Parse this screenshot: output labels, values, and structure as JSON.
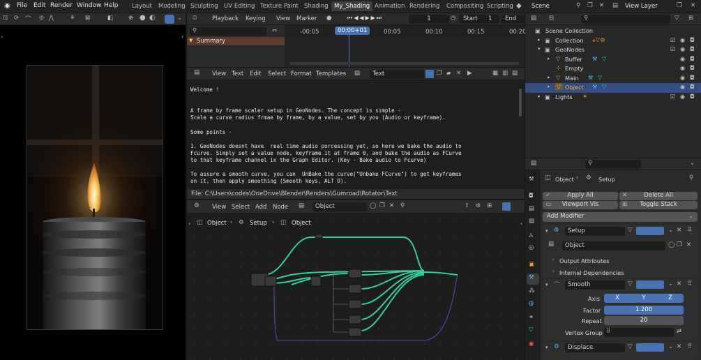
{
  "menu": [
    "File",
    "Edit",
    "Render",
    "Window",
    "Help"
  ],
  "workspaces": [
    "Layout",
    "Modeling",
    "Sculpting",
    "UV Editing",
    "Texture Paint",
    "Shading",
    "My_Shading",
    "Animation",
    "Rendering",
    "Compositing",
    "Scripting"
  ],
  "active_workspace": "My_Shading",
  "scene": {
    "name": "Scene",
    "view_layer": "View Layer"
  },
  "timeline": {
    "menus": [
      "Playback",
      "Keying",
      "View",
      "Marker"
    ],
    "current_frame": "1",
    "start_label": "Start",
    "start_value": "1",
    "end_label": "End",
    "ruler": [
      "-00:05",
      "00:00+01",
      "00:05",
      "00:10",
      "00:15",
      "00:20"
    ],
    "summary": "Summary"
  },
  "text_editor": {
    "menus": [
      "View",
      "Text",
      "Edit",
      "Select",
      "Format",
      "Templates"
    ],
    "datablock": "Text",
    "lines": [
      "Welcome !",
      "",
      "",
      "A frame by frame scaler setup in GeoNodes. The concept is simple -",
      "Scale a curve radius frmae by frame, by a value, set by you (Audio or keyframe).",
      "",
      "Some points -",
      "",
      "1. GeoNodes doesnt have  real time audio porcessing yet, so here we bake the audio to",
      "Fcurve. Simply set a value node, keyframe it at frame 0, and bake the audio as FCurve",
      "to that keyframe channel in the Graph Editor. (Key - Bake audio to Fcurve)",
      "",
      "To assure a smooth curve, you can  UnBake the curve(\"Unbake FCurve\") to get keyframes",
      "on it, then apply smoothing (Smooth keys, ALT O)."
    ],
    "file_path": "File: C:\\Users\\codes\\OneDrive\\Blender\\Renders\\Gumroad\\Rotator\\Text"
  },
  "node_editor": {
    "menus": [
      "View",
      "Select",
      "Add",
      "Node"
    ],
    "object": "Object",
    "breadcrumb": [
      "Object",
      "Setup",
      "Object"
    ]
  },
  "outliner": {
    "root": "Scene Collection",
    "items": [
      {
        "label": "Collection"
      },
      {
        "label": "GeoNodes"
      },
      {
        "label": "Buffer"
      },
      {
        "label": "Empty"
      },
      {
        "label": "Main"
      },
      {
        "label": "Object"
      },
      {
        "label": "Lights"
      }
    ]
  },
  "properties": {
    "object": "Object",
    "modifier": "Setup",
    "apply_all": "Apply All",
    "delete_all": "Delete All",
    "viewport_vis": "Viewport Vis",
    "toggle_stack": "Toggle Stack",
    "add_modifier": "Add Modifier",
    "setup_name": "Setup",
    "setup_object": "Object",
    "output_attributes": "Output Attributes",
    "internal_dependencies": "Internal Dependencies",
    "smooth_name": "Smooth",
    "axis_label": "Axis",
    "axes": [
      "X",
      "Y",
      "Z"
    ],
    "factor_label": "Factor",
    "factor_value": "1.200",
    "repeat_label": "Repeat",
    "repeat_value": "20",
    "vertex_group_label": "Vertex Group",
    "displace_name": "Displace"
  },
  "colors": {
    "accent": "#4772b3",
    "node_link": "#2fd39a",
    "selection": "#334d80"
  }
}
